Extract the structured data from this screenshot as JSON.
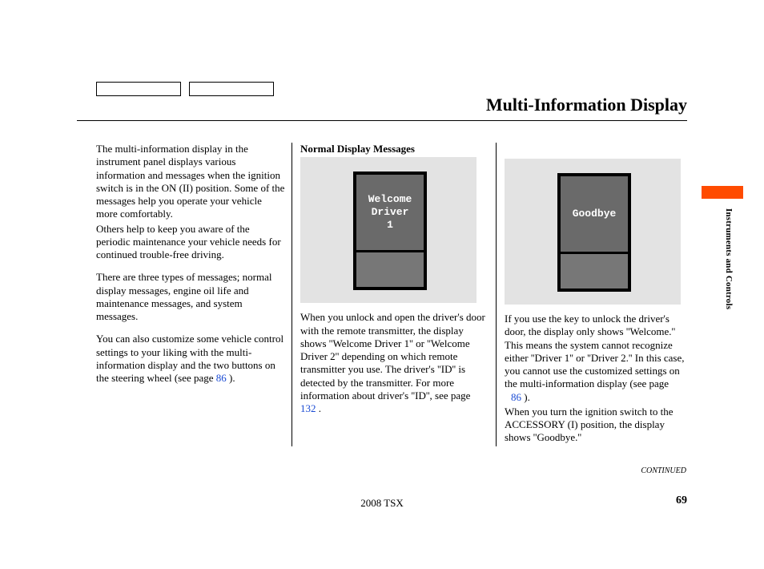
{
  "header": {
    "title": "Multi-Information Display"
  },
  "col1": {
    "p1": "The multi-information display in the instrument panel displays various information and messages when the ignition switch is in the ON (II) position. Some of the messages help you operate your vehicle more comfortably.",
    "p1b": "Others help to keep you aware of the periodic maintenance your vehicle needs for continued trouble-free driving.",
    "p2": "There are three types of messages; normal display messages, engine oil life and maintenance messages, and system messages.",
    "p3a": "You can also customize some vehicle control settings to your liking with the multi-information display and the two buttons on the steering wheel (see page ",
    "p3link": "86",
    "p3b": " )."
  },
  "col2": {
    "subhead": "Normal Display Messages",
    "display_line1": "Welcome",
    "display_line2": "Driver",
    "display_line3": "1",
    "p1a": "When you unlock and open the driver's door with the remote transmitter, the display shows ''Welcome Driver 1'' or ''Welcome Driver 2'' depending on which remote transmitter you use. The driver's ''ID'' is detected by the transmitter. For more information about driver's ''ID'', see page ",
    "p1link": "132",
    "p1b": " ."
  },
  "col3": {
    "display_line1": "Goodbye",
    "p1a": "If you use the key to unlock the driver's door, the display only shows ''Welcome.'' This means the system cannot recognize either ''Driver 1'' or ''Driver 2.'' In this case, you cannot use the customized settings on the multi-information display (see page ",
    "p1link": "86",
    "p1b": " ).",
    "p2": "When you turn the ignition switch to the ACCESSORY (I) position, the display shows ''Goodbye.''"
  },
  "side": {
    "label": "Instruments and Controls"
  },
  "footer": {
    "continued": "CONTINUED",
    "model": "2008 TSX",
    "page_num": "69"
  }
}
